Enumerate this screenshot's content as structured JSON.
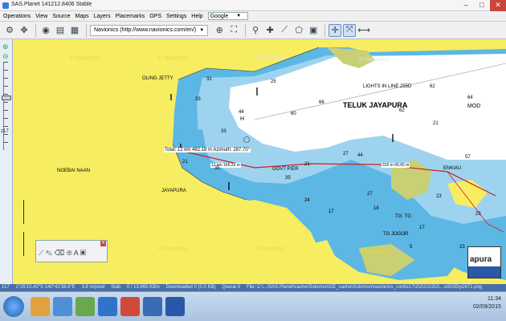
{
  "window": {
    "title": "SAS.Planet 141212.8406 Stable",
    "minimize": "–",
    "maximize": "□",
    "close": "✕"
  },
  "menu": {
    "items": [
      "Operations",
      "View",
      "Source",
      "Maps",
      "Layers",
      "Placemarks",
      "GPS",
      "Settings",
      "Help"
    ],
    "search_engine": "Google"
  },
  "toolbar": {
    "map_source": "Navionics (http://www.navionics.com/en/)",
    "icons": [
      "settings-icon",
      "move-icon",
      "globe-icon",
      "layers-icon",
      "grid-icon",
      "zoom-icon",
      "fullscreen-icon",
      "marker-icon",
      "add-point-icon",
      "polyline-icon",
      "polygon-icon",
      "calc-icon",
      "select-icon",
      "measure-icon"
    ]
  },
  "left_panel": {
    "zoom_level": "z17"
  },
  "map": {
    "watermark": "© Navionics",
    "labels": {
      "teluk": "TELUK JAYAPURA",
      "oling": "OLING JETTY",
      "noebai": "NOEBAI NAAN",
      "jayapura": "JAYAPURA",
      "govt": "GOVT PIER",
      "lights": "LIGHTS IN LINE 255D",
      "tg_jogor": "TG JOGOR",
      "tg_lower": "TG. TG",
      "enkiau": "ENKIAU",
      "mod": "MOD",
      "h": "H"
    },
    "measurement": {
      "total": "Total: 12 km 482.18 m Azimuth: 287.70°",
      "seg1": "12 km 166.29 m",
      "seg2": "315 m 66.65 m"
    },
    "depths": [
      "31",
      "25",
      "33",
      "44",
      "60",
      "66",
      "62",
      "62",
      "64",
      "57",
      "21",
      "27",
      "27",
      "23",
      "21",
      "35",
      "33",
      "24",
      "44",
      "17",
      "23",
      "21",
      "17",
      "35",
      "5",
      "23",
      "18"
    ]
  },
  "popup": {
    "text": "apura"
  },
  "statusbar": {
    "items": [
      "z17",
      "1°25'10.42\"S 140°42'38.8\"E",
      "3.8 m/pixel",
      "Slab",
      "0 / 13.865 KB/s",
      "Downloaded 0 (0.0 KB)",
      "Queue 0",
      "File: C:\\...\\SAS.Planet\\cache\\Solomon\\GE_cache\\Solomon\\navionics_cont\\z17\\2\\2\\1\\1\\3\\2\\...\\x5035\\y2671.png"
    ]
  },
  "taskbar": {
    "time": "11:34",
    "date": "02/09/2015"
  },
  "colors": {
    "land": "#f6ed61",
    "shallow": "#5cb7e4",
    "mid": "#9ed3f0",
    "deep": "#ffffff",
    "route": "#cc1e1e",
    "reef": "#c8cf74"
  }
}
